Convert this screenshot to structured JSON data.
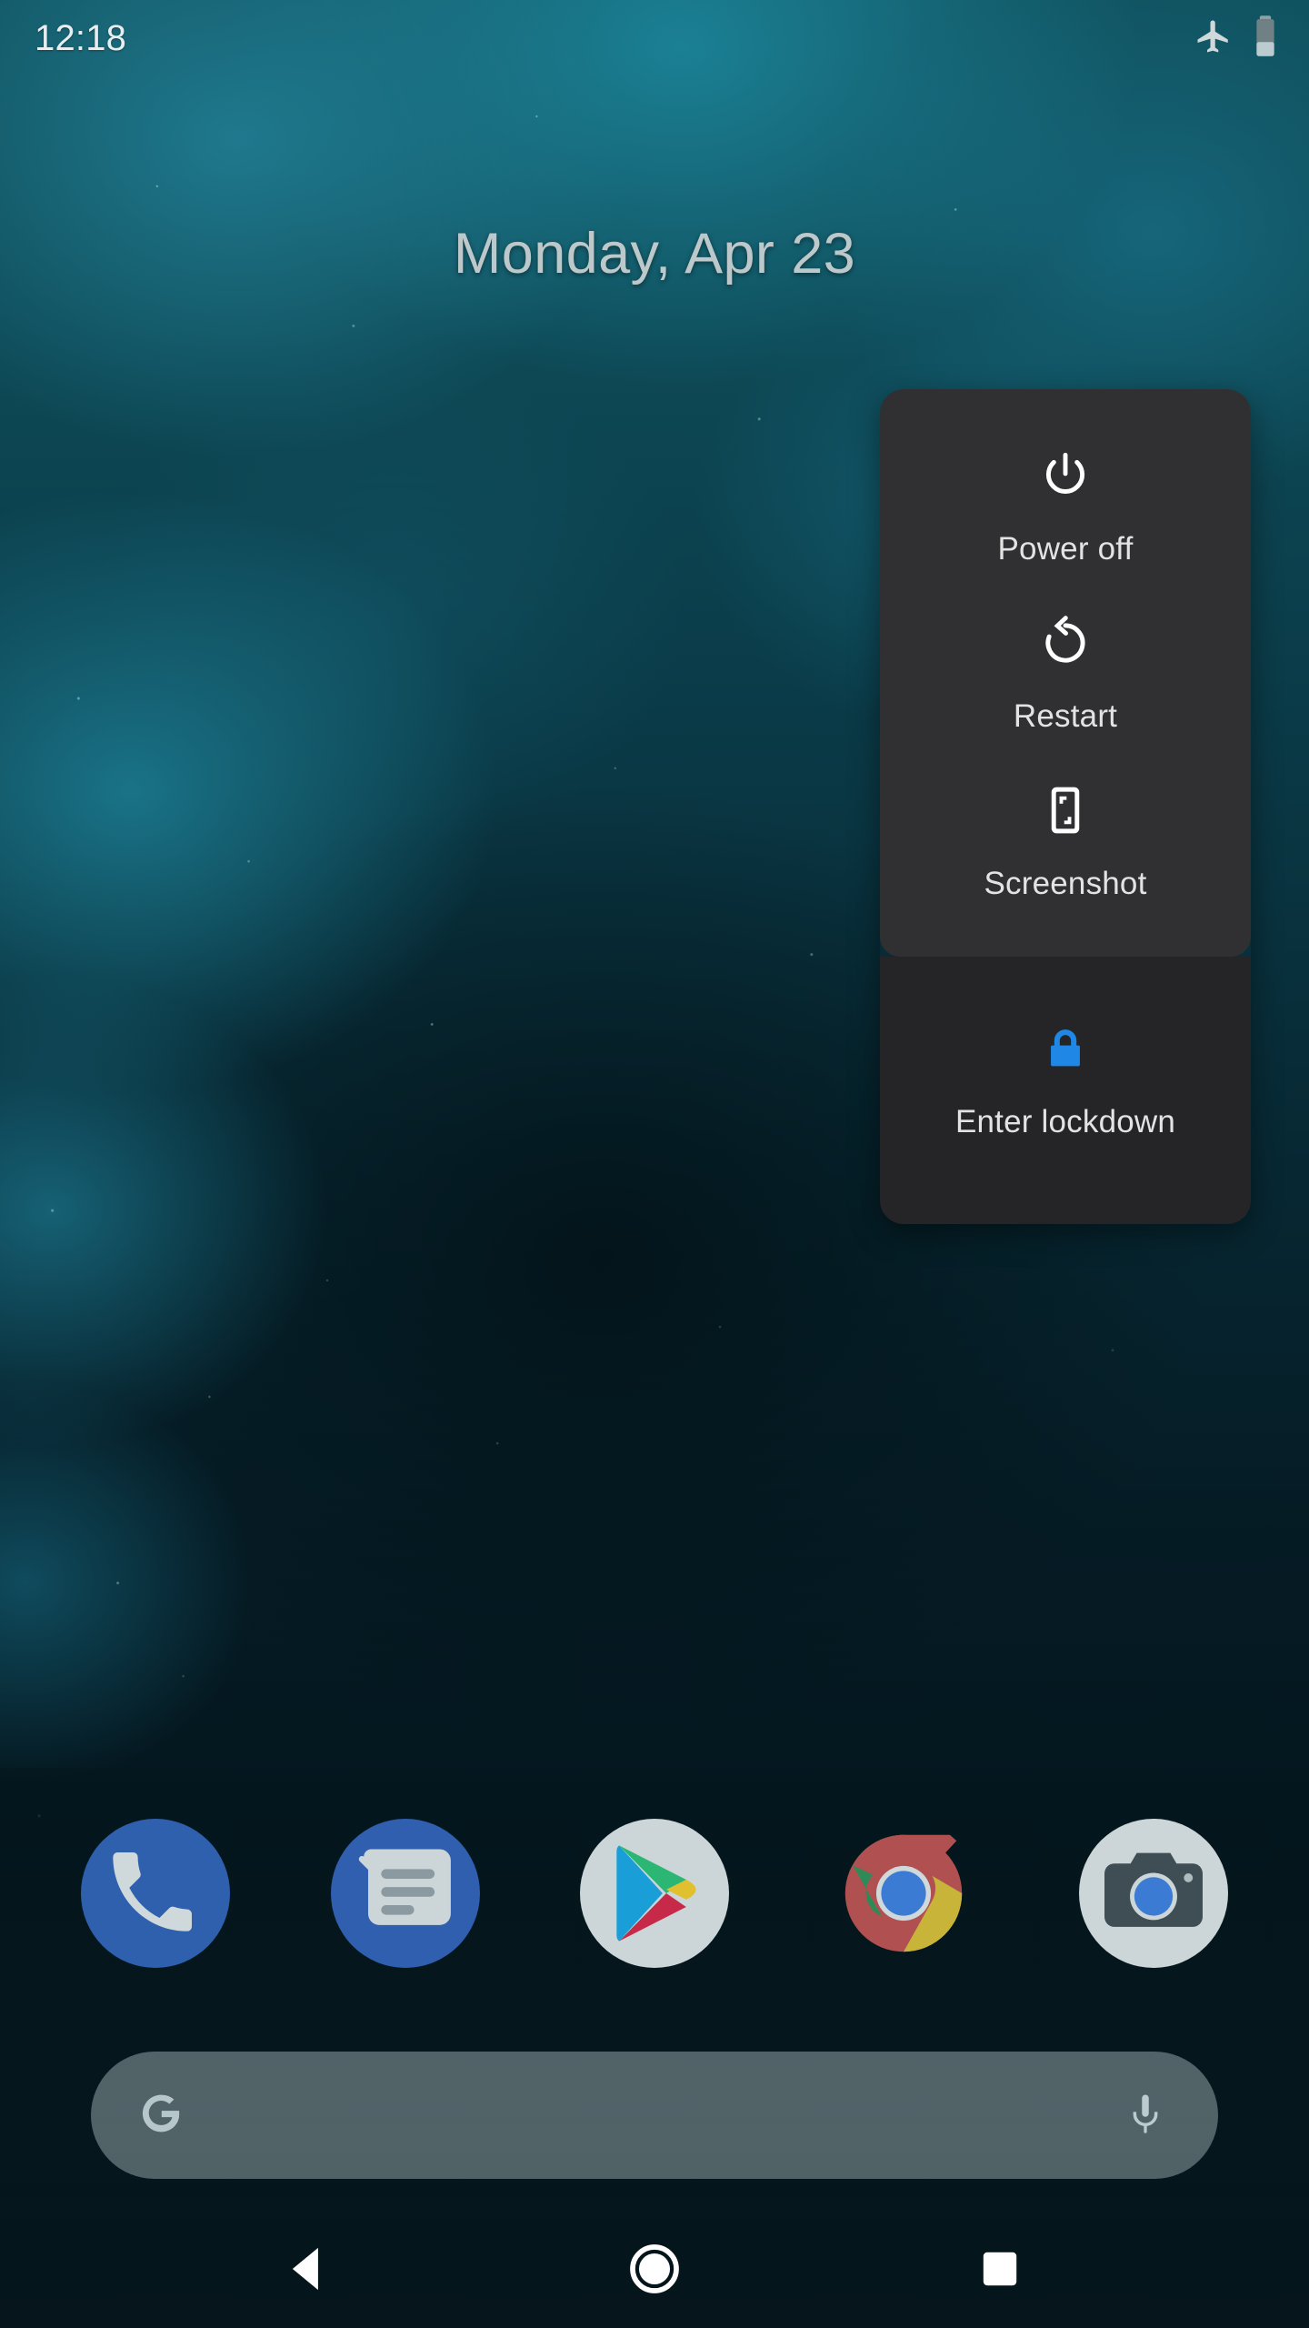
{
  "status_bar": {
    "clock": "12:18",
    "icons": [
      {
        "name": "airplane-mode-icon",
        "label": "Airplane mode"
      },
      {
        "name": "battery-icon",
        "label": "Battery",
        "level_percent": 32
      }
    ]
  },
  "date_widget": {
    "date": "Monday, Apr 23"
  },
  "power_menu": {
    "sections": [
      {
        "id": "main",
        "background": "#303032",
        "items": [
          {
            "id": "power-off",
            "label": "Power off",
            "icon": "power-icon",
            "icon_color": "#ffffff"
          },
          {
            "id": "restart",
            "label": "Restart",
            "icon": "restart-icon",
            "icon_color": "#ffffff"
          },
          {
            "id": "screenshot",
            "label": "Screenshot",
            "icon": "screenshot-icon",
            "icon_color": "#ffffff"
          }
        ]
      },
      {
        "id": "lockdown",
        "background": "#252527",
        "items": [
          {
            "id": "enter-lockdown",
            "label": "Enter lockdown",
            "icon": "lock-icon",
            "icon_color": "#1f87e5"
          }
        ]
      }
    ]
  },
  "dock": {
    "apps": [
      {
        "id": "phone",
        "label": "Phone",
        "icon": "phone-icon",
        "bg_color": "#2f60ae"
      },
      {
        "id": "messages",
        "label": "Messages",
        "icon": "messages-icon",
        "bg_color": "#2f5fae"
      },
      {
        "id": "play-store",
        "label": "Play Store",
        "icon": "play-store-icon",
        "bg_color": "#ccd6d8"
      },
      {
        "id": "chrome",
        "label": "Chrome",
        "icon": "chrome-icon",
        "bg_color": "#ffffff"
      },
      {
        "id": "camera",
        "label": "Camera",
        "icon": "camera-icon",
        "bg_color": "#ccd6d8"
      }
    ]
  },
  "search_bar": {
    "placeholder": "",
    "value": "",
    "left_icon": "google-g-icon",
    "right_icon": "microphone-icon",
    "background": "rgba(196,214,218,0.40)"
  },
  "nav_bar": {
    "buttons": [
      {
        "id": "back",
        "label": "Back",
        "icon": "back-triangle-icon"
      },
      {
        "id": "home",
        "label": "Home",
        "icon": "home-circle-icon"
      },
      {
        "id": "recents",
        "label": "Recents",
        "icon": "recents-square-icon"
      }
    ]
  },
  "colors": {
    "wallpaper_top": "#10525f",
    "wallpaper_bottom": "#04151d",
    "menu_surface": "#303032",
    "menu_surface_alt": "#252527",
    "accent_blue": "#1f87e5",
    "text_primary": "#e3e3e3",
    "date_text": "#bdc8ca"
  }
}
